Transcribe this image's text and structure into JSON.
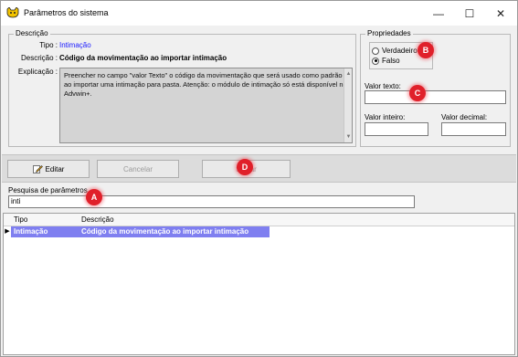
{
  "window": {
    "title": "Parâmetros do sistema",
    "controls": {
      "minimize": "—",
      "maximize": "☐",
      "close": "✕"
    }
  },
  "descricao_group": {
    "legend": "Descrição",
    "tipo_label": "Tipo :",
    "tipo_value": "Intimação",
    "descricao_label": "Descrição :",
    "descricao_value": "Código da movimentação ao importar intimação",
    "explicacao_label": "Explicação :",
    "explicacao_text": "Preencher no campo \"valor Texto\" o código da movimentação que será usado como padrão ao importar uma intimação para pasta. Atenção: o módulo de intimação só está disponível no Advwin+."
  },
  "propriedades_group": {
    "legend": "Propriedades",
    "options": [
      {
        "label": "Verdadeiro",
        "checked": false
      },
      {
        "label": "Falso",
        "checked": true
      }
    ],
    "valor_texto_label": "Valor texto:",
    "valor_texto_value": "",
    "valor_inteiro_label": "Valor inteiro:",
    "valor_inteiro_value": "",
    "valor_decimal_label": "Valor decimal:",
    "valor_decimal_value": ""
  },
  "toolbar": {
    "editar_label": "Editar",
    "cancelar_label": "Cancelar",
    "salvar_label": "Salvar"
  },
  "search": {
    "label": "Pesquisa de parâmetros",
    "value": "inti"
  },
  "grid": {
    "columns": [
      "Tipo",
      "Descrição"
    ],
    "rows": [
      {
        "marker": "▶",
        "tipo": "Intimação",
        "descricao": "Código da movimentação ao importar intimação",
        "selected": true
      }
    ]
  },
  "callouts": [
    "A",
    "B",
    "C",
    "D"
  ],
  "colors": {
    "selection": "#7f7ff0",
    "callout": "#e0202a",
    "tipo_value": "#1a1aff"
  },
  "icons": {
    "app": "cat-logo-icon",
    "edit": "pencil-edit-icon"
  }
}
